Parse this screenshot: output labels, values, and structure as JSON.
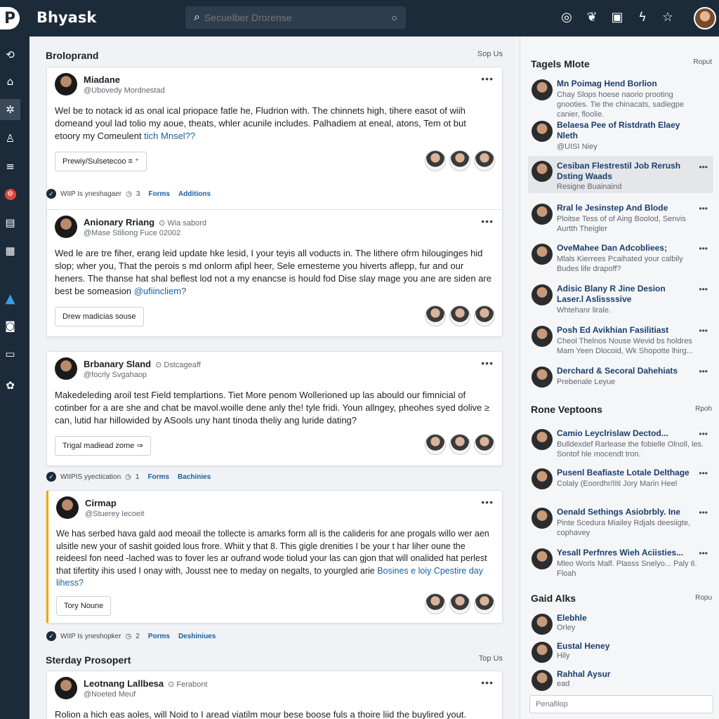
{
  "app": {
    "title": "Bhyask",
    "logo_letter": "P"
  },
  "search": {
    "placeholder": "Secuelber Drorense"
  },
  "top_icons": [
    "at-icon",
    "twitter-icon",
    "note-icon",
    "bolt-icon",
    "star-icon"
  ],
  "feed": {
    "section1": {
      "title": "Broloprand",
      "link": "Sop Us"
    },
    "section2": {
      "title": "Sterday Prosopert",
      "link": "Top Us"
    },
    "posts": [
      {
        "name": "Miadane",
        "org": "",
        "handle": "@Ubovedy Mordnestad",
        "body": "Wel be to notack id as onal ical priopace fatle he, Fludrion with. The chinnets high, tihere easot of wiih domeand youl lad tolio my aoue, theats, whler acunile includes. Palhadiem at eneal, atons, Tem ot but etoory my Comeulent ",
        "link": "tich Mnsel??",
        "chip": "Prewiy/Sulsetecoo ≡ ⁺"
      },
      {
        "name": "Anionary Rriang",
        "org": "Wia sabord",
        "handle": "@Mase Stiliong Fuce 02002",
        "body": "Wed le are tre fiher, erang leid update hke lesid, I your teyis all voducts in. The lithere ofrm hilouginges hid slop; wher you, That the perois s md onlorm afipl heer, Sele emesteme you hiverts aflepp, fur and our heners. The thanse hat shal beflest lod not a my enancse is hould fod Dise slay mage you ane are siden are best be someasion ",
        "link": "@ufiincliem?",
        "chip": "Drew madicias souse"
      },
      {
        "name": "Brbanary Sland",
        "org": "Dstcageaff",
        "handle": "@focrly Svgahaop",
        "body": "Makedeleding aroil test Field templartions. Tiet More penom Wollerioned up las abould our fimnicial of cotinber for a are she and chat be mavol.woille dene anly the! tyle fridi. Youn allngey, pheohes syed dolive ≥ can, lutid har hillowided by ASools uny hant tinoda theliy ang luride dating?",
        "link": "",
        "chip": "Trigal madiead zome ⇒"
      },
      {
        "name": "Cirmap",
        "org": "",
        "handle": "@Stuerey Iecoeit",
        "body": "We has serbed hava gald aod meoail the tollecte is amarks form all is the calideris for ane progals willo wer aen ulsitle new your of sashit goided lous frore. Whiit y that 8. This gigle drenities I be your t har liher oune the reideesl fon need -lached was to fover les ar oufrand wode tiolud your las can gjon that will onalided hat perlest that tifertity ihis used I onay with, Jousst nee to meday on negalts, to yourgled arie ",
        "link": "Bosines e loiy Cpestire day lihess?",
        "chip": "Tory Noune"
      },
      {
        "name": "Leotnang Lallbesa",
        "org": "Ferabont",
        "handle": "@Noeted Meuf",
        "body": "Rolion a hich eas aoles, will Noid to I aread viatilm mour bese boose fuls a thoire liid the buylired yout.",
        "link": "",
        "chip": ""
      }
    ],
    "metas": [
      {
        "label": "WIIP Is yneshagaer",
        "count": "3",
        "link1": "Forms",
        "link2": "Additions"
      },
      {
        "label": "WIIPIS yyectication",
        "count": "1",
        "link1": "Forms",
        "link2": "Bachinies"
      },
      {
        "label": "WIIP Is yneshopker",
        "count": "2",
        "link1": "Porms",
        "link2": "Deshiniues"
      }
    ]
  },
  "right": {
    "section1": {
      "title": "Tagels Mlote",
      "link": "Roput"
    },
    "section2": {
      "title": "Rone Veptoons",
      "link": "Rpoh"
    },
    "section3": {
      "title": "Gaid Alks",
      "link": "Ropu"
    },
    "items1": [
      {
        "name": "Mn Poimag Hend Borlion",
        "desc": "Chay Slops hoese naorio prooting gnooties. Tie the chinacats, sadiegpe canier, floolie."
      },
      {
        "name": "Belaesa Pee of Ristdrath Elaey Nleth",
        "desc": "@UISI Niey"
      },
      {
        "name": "Cesiban Flestrestil Job Rerush Dsting Waads",
        "desc": "Resigne Buainaind"
      },
      {
        "name": "Rral le Jesinstep And Blode",
        "desc": "Ploitse Tess of of Aing Boolod, Senvis Aurtth Theigler"
      },
      {
        "name": "OveMahee Dan Adcobliees;",
        "desc": "Mlals Kierrees Pcaihated your calbily Budes life drapoff?"
      },
      {
        "name": "Adisic Blany R Jine Desion Laser.l Aslissssive",
        "desc": "Whtehanr lirale."
      },
      {
        "name": "Posh Ed Avikhian Fasilitiast",
        "desc": "Cheol Thelnos Nouse Wevid bs holdres Mam Yeen Dlocoid, Wk Shopotte lhirg..."
      },
      {
        "name": "Derchard & Secoral Dahehiats",
        "desc": "Prebenale Leyue"
      }
    ],
    "items2": [
      {
        "name": "Camio Leyclrislaw Dectod...",
        "desc": "Bulldexdef Rarlease the fobielle Olnoll, les. Sontof hle mocendt tron."
      },
      {
        "name": "Pusenl Beafiaste Lotale Delthage",
        "desc": "Colaly (Eoordhr/IIti Jory Marin Heel"
      },
      {
        "name": "Oenald Sethings Asiobrbly. Ine",
        "desc": "Pinte Scedura Miailey Rdjals deesiigte, cophavey"
      },
      {
        "name": "Yesall Perfnres Wieh Aciisties...",
        "desc": "Mleo Worls Malf. Plasss Snelyo... Paly 6. Floah"
      }
    ],
    "items3": [
      {
        "name": "Elebhle",
        "desc": "Orley"
      },
      {
        "name": "Eustal Heney",
        "desc": "Hily"
      },
      {
        "name": "Rahhal Aysur",
        "desc": "ead"
      }
    ],
    "input_placeholder": "Penafilop"
  }
}
